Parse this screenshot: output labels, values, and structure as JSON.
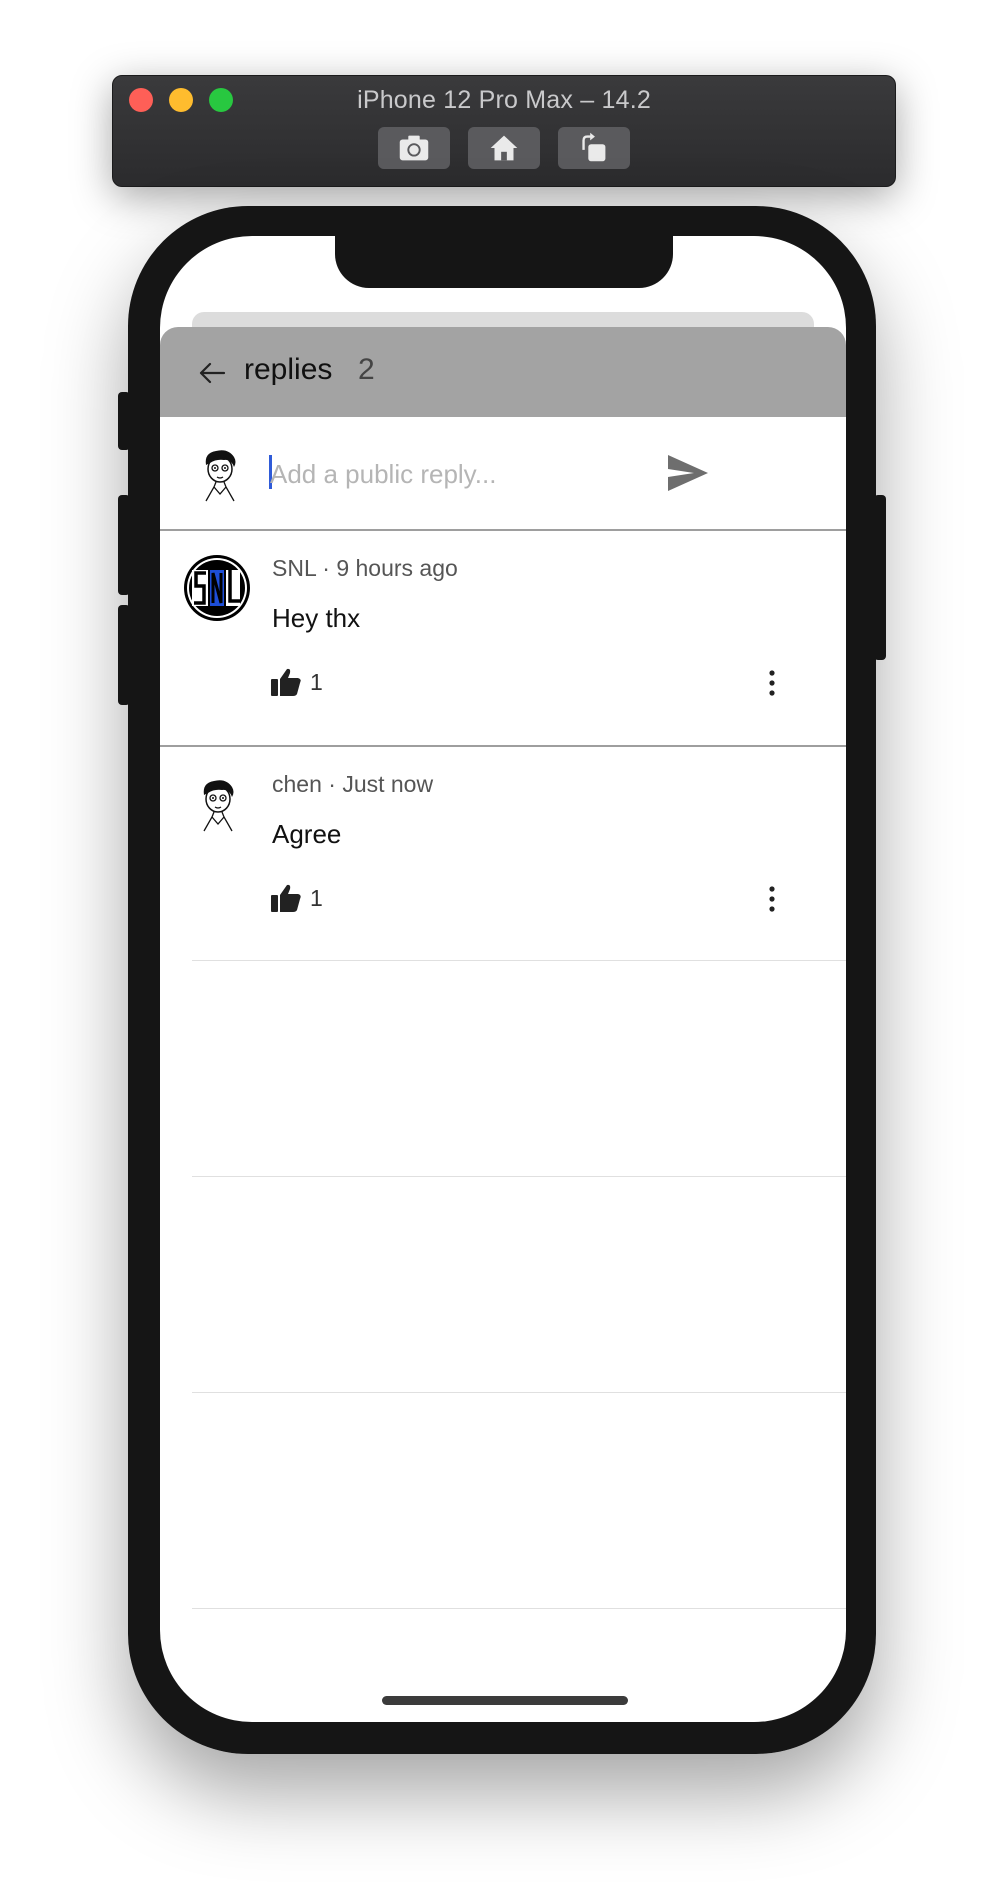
{
  "simulator": {
    "title": "iPhone 12 Pro Max – 14.2",
    "buttons": [
      {
        "icon": "camera-icon"
      },
      {
        "icon": "home-icon"
      },
      {
        "icon": "rotate-icon"
      }
    ]
  },
  "header": {
    "title": "replies",
    "count": "2",
    "back_icon": "arrow-left-icon"
  },
  "reply_input": {
    "placeholder": "Add a public reply...",
    "value": "",
    "send_icon": "send-icon"
  },
  "comments": [
    {
      "author": "SNL",
      "time": "9 hours ago",
      "meta": "SNL · 9 hours ago",
      "text": "Hey thx",
      "likes": "1",
      "avatar": "snl-logo"
    },
    {
      "author": "chen",
      "time": "Just now",
      "meta": "chen · Just now",
      "text": "Agree",
      "likes": "1",
      "avatar": "sketch-avatar"
    }
  ],
  "colors": {
    "header_bg": "#a3a3a3",
    "caret": "#2f5bd8",
    "snl_blue": "#1d4ed8"
  }
}
